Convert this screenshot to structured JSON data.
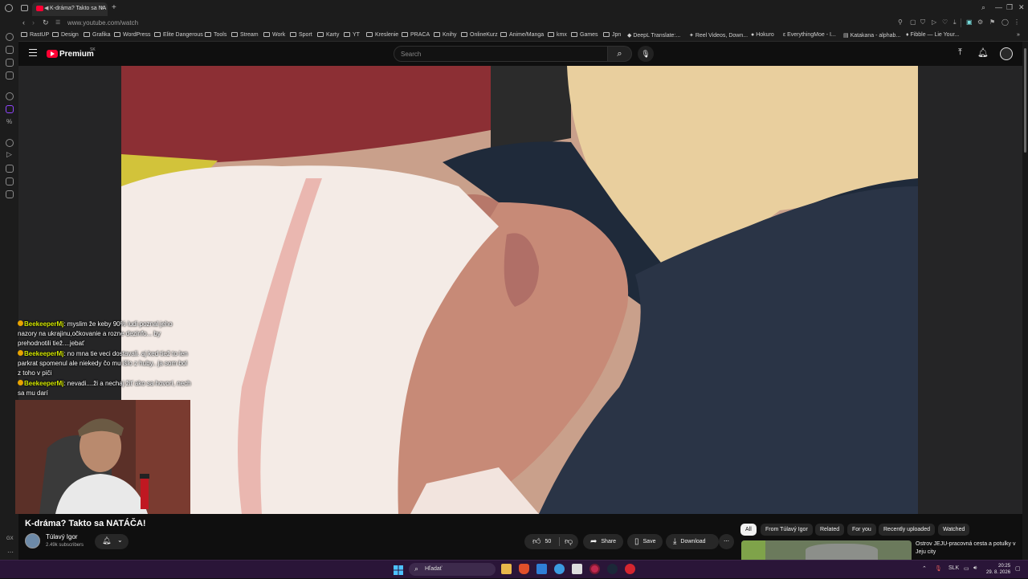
{
  "browser": {
    "tab_title": "K-dráma? Takto sa NA",
    "url": "www.youtube.com/watch",
    "bookmarks": [
      "RastUP",
      "Design",
      "Grafika",
      "WordPress",
      "Elite Dangerous",
      "Tools",
      "Stream",
      "Work",
      "Sport",
      "Karty",
      "YT",
      "Kreslenie",
      "PRACA",
      "Knihy",
      "OnlineKurz",
      "Anime/Manga",
      "kmx",
      "Games",
      "Jpn",
      "DeepL Translate:...",
      "Reel Videos, Down...",
      "Hokuro",
      "EverythingMoe - I...",
      "Katakana - alphab...",
      "Fibble — Lie Your..."
    ]
  },
  "youtube": {
    "logo_text": "Premium",
    "country_code": "SK",
    "search_placeholder": "Search"
  },
  "chat": [
    {
      "user": "BeekeeperMj",
      "text": ": myslim že keby 90% ludi poznal jeho nazory na ukrajinu,očkovanie a rozne dezinfo... by prehodnotili tiež....jebať"
    },
    {
      "user": "BeekeeperMj",
      "text": ": no mna tie veci dostavali. aj ked tiež to len parkrat spomenul ale niekedy čo mu išlo z huby.. ja som bol z toho v piči"
    },
    {
      "user": "BeekeeperMj",
      "text": ": nevadi....ži a nechaj žiť ako sa hovorí, nech sa mu darí"
    }
  ],
  "video": {
    "title": "K-dráma? Takto sa NATÁČA!",
    "channel_name": "Túlavý Igor",
    "subscribers": "2.49k subscribers",
    "likes": "50",
    "share_label": "Share",
    "save_label": "Save",
    "download_label": "Download"
  },
  "chips": [
    "All",
    "From Túlavý Igor",
    "Related",
    "For you",
    "Recently uploaded",
    "Watched"
  ],
  "recommendation": {
    "title": "Ostrov JEJU-pracovná cesta a potulky v Jeju city"
  },
  "left_mini": "GX",
  "taskbar": {
    "search_placeholder": "Hľadať",
    "language": "SLK",
    "time": "20:25",
    "date": "29. 8. 2026"
  }
}
